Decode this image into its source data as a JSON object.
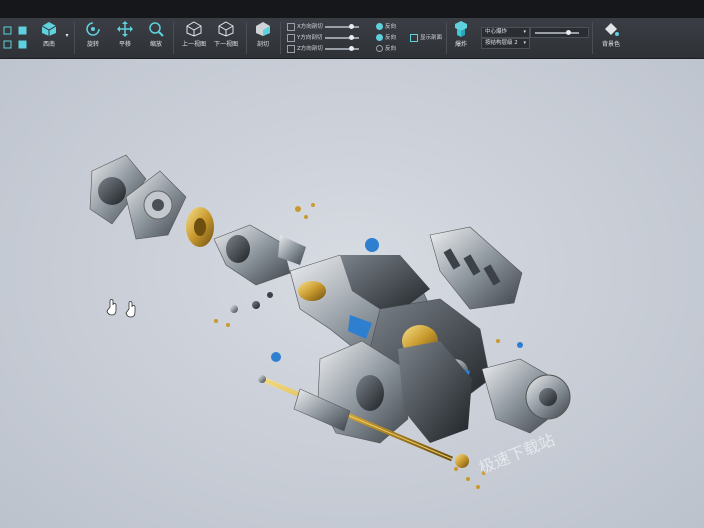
{
  "toolbar": {
    "view_button": {
      "label": "西南",
      "icon": "isometric-cube-icon"
    },
    "rotate": {
      "label": "旋转",
      "icon": "rotate-icon"
    },
    "pan": {
      "label": "平移",
      "icon": "pan-arrows-icon"
    },
    "zoom": {
      "label": "缩放",
      "icon": "magnifier-icon"
    },
    "prev_view": {
      "label": "上一视图",
      "icon": "prev-view-cube-icon"
    },
    "next_view": {
      "label": "下一视图",
      "icon": "next-view-cube-icon"
    },
    "clip": {
      "label": "剖切",
      "icon": "section-cube-icon"
    },
    "sections": [
      {
        "label": "X方向剖切",
        "reverse": "反向",
        "value": 0.75,
        "reverse_selected": true
      },
      {
        "label": "Y方向剖切",
        "reverse": "反向",
        "value": 0.75,
        "reverse_selected": true
      },
      {
        "label": "Z方向剖切",
        "reverse": "反向",
        "value": 0.75,
        "reverse_selected": false
      }
    ],
    "show_cap": "显示剖面",
    "explode": {
      "label": "爆炸",
      "icon": "explode-cube-icon"
    },
    "explode_mode": "中心爆炸",
    "explode_level": "按结构层级 2",
    "explode_value": 0.75,
    "background": {
      "label": "背景色",
      "icon": "paint-bucket-icon"
    }
  },
  "viewport": {
    "watermark": "极速下载站",
    "cursor_icons": [
      "hand-cursor-icon",
      "hand-cursor-icon"
    ]
  },
  "colors": {
    "accent": "#3ec8d8",
    "toolbar_bg": "#33373c",
    "viewport_bg": "#c9ced7",
    "metal": "#9aa3ad",
    "gold": "#c9a23c",
    "blue_part": "#2f7fd0"
  }
}
